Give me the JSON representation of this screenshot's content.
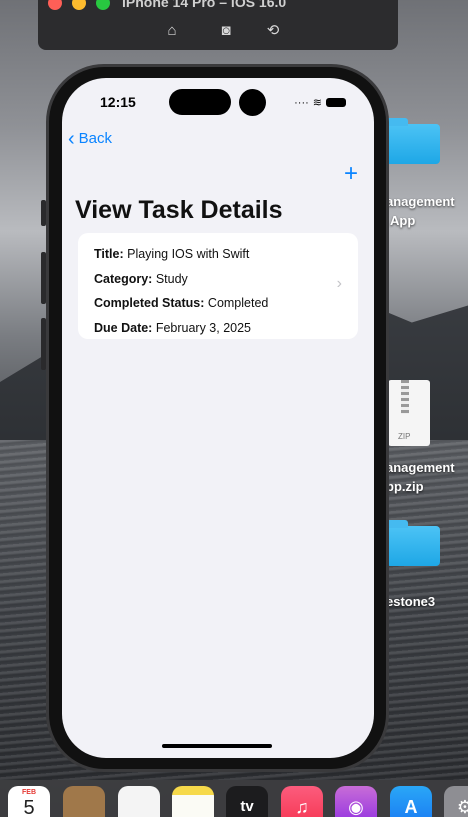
{
  "simulator": {
    "title": "iPhone 14 Pro – iOS 16.0",
    "toolbar_icons": [
      "home-icon",
      "screenshot-icon",
      "rotate-icon"
    ]
  },
  "status_bar": {
    "time": "12:15",
    "icons": [
      "signal-icon",
      "wifi-icon",
      "battery-icon"
    ]
  },
  "nav": {
    "back_label": "Back",
    "add_label": "+"
  },
  "page": {
    "title": "View Task Details"
  },
  "task": {
    "title_label": "Title:",
    "title_value": " Playing IOS with Swift",
    "category_label": "Category:",
    "category_value": " Study",
    "status_label": "Completed Status:",
    "status_value": " Completed",
    "due_label": "Due Date:",
    "due_value": " February 3, 2025"
  },
  "desktop": {
    "items": [
      {
        "label_line1": "anagement",
        "label_line2": "App",
        "type": "folder-icon"
      },
      {
        "label_line1": "anagement",
        "label_line2": "pp.zip",
        "type": "zip-icon",
        "badge": "ZIP"
      },
      {
        "label_line1": "estone3",
        "type": "folder-icon"
      }
    ]
  },
  "dock": {
    "calendar": {
      "month": "FEB",
      "day": "5"
    },
    "apps": [
      "calendar-icon",
      "contacts-icon",
      "reminders-icon",
      "notes-icon",
      "tv-icon",
      "music-icon",
      "podcasts-icon",
      "app-store-icon",
      "settings-icon"
    ],
    "tv_label": "tv"
  },
  "colors": {
    "accent": "#0a84ff",
    "screen_bg": "#f2f2f7",
    "card_bg": "#ffffff"
  }
}
